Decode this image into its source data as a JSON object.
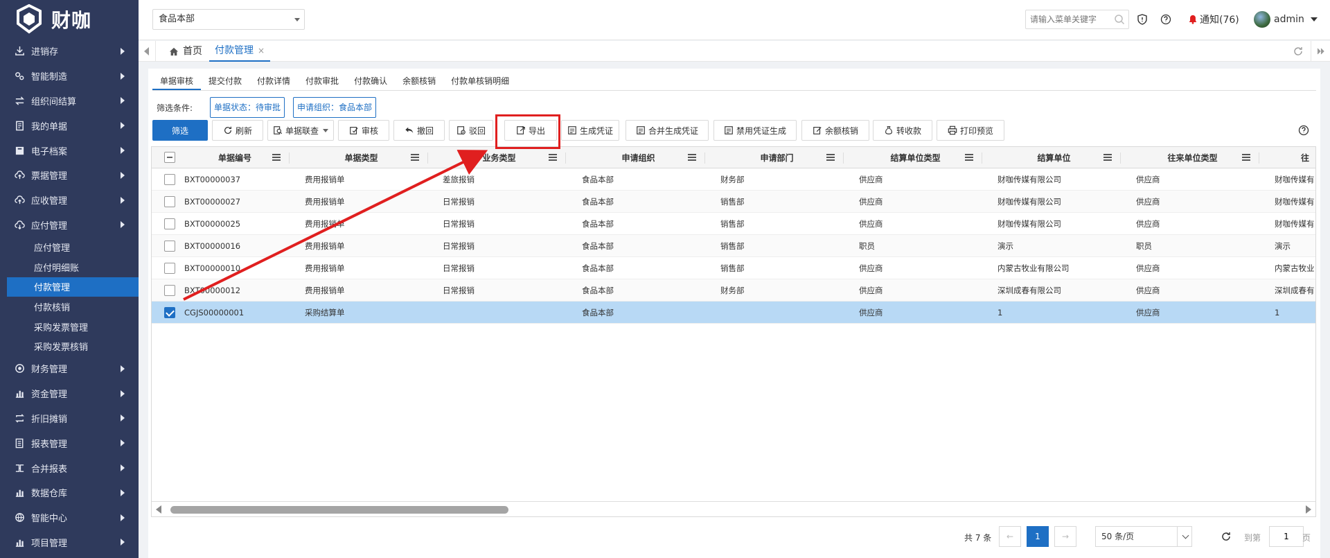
{
  "app": {
    "logo_text": "财咖"
  },
  "sidebar": {
    "items": [
      {
        "label": "进销存",
        "icon": "download-icon"
      },
      {
        "label": "智能制造",
        "icon": "gears-icon"
      },
      {
        "label": "组织间结算",
        "icon": "exchange-icon"
      },
      {
        "label": "我的单据",
        "icon": "document-icon"
      },
      {
        "label": "电子档案",
        "icon": "archive-icon"
      },
      {
        "label": "票据管理",
        "icon": "cloud-upload-icon"
      },
      {
        "label": "应收管理",
        "icon": "cloud-upload-icon"
      },
      {
        "label": "应付管理",
        "icon": "cloud-download-icon"
      }
    ],
    "submenu": [
      {
        "label": "应付管理"
      },
      {
        "label": "应付明细账"
      },
      {
        "label": "付款管理",
        "active": true
      },
      {
        "label": "付款核销"
      },
      {
        "label": "采购发票管理"
      },
      {
        "label": "采购发票核销"
      }
    ],
    "items_after": [
      {
        "label": "财务管理",
        "icon": "circle-dot-icon"
      },
      {
        "label": "资金管理",
        "icon": "bar-chart-icon"
      },
      {
        "label": "折旧摊销",
        "icon": "repeat-icon"
      },
      {
        "label": "报表管理",
        "icon": "report-icon"
      },
      {
        "label": "合并报表",
        "icon": "merge-icon"
      },
      {
        "label": "数据仓库",
        "icon": "bar-chart-icon"
      },
      {
        "label": "智能中心",
        "icon": "globe-icon"
      },
      {
        "label": "项目管理",
        "icon": "bar-chart-icon"
      }
    ]
  },
  "header": {
    "org_select": "食品本部",
    "search_placeholder": "请输入菜单关键字",
    "notification": "通知(76)",
    "username": "admin"
  },
  "tabs": {
    "home": "首页",
    "active": "付款管理",
    "close": "×"
  },
  "subtabs": [
    "单据审核",
    "提交付款",
    "付款详情",
    "付款审批",
    "付款确认",
    "余额核销",
    "付款单核销明细"
  ],
  "filter": {
    "label": "筛选条件:",
    "tags": [
      "单据状态：待审批",
      "申请组织：食品本部"
    ]
  },
  "toolbar": {
    "filter": "筛选",
    "refresh": "刷新",
    "linked": "单据联查",
    "audit": "审核",
    "withdraw": "撤回",
    "reject": "驳回",
    "export": "导出",
    "gen_voucher": "生成凭证",
    "merge_voucher": "合并生成凭证",
    "disable_voucher": "禁用凭证生成",
    "balance_writeoff": "余额核销",
    "transfer_receipt": "转收款",
    "print_preview": "打印预览"
  },
  "table": {
    "columns": [
      "单据编号",
      "单据类型",
      "业务类型",
      "申请组织",
      "申请部门",
      "结算单位类型",
      "结算单位",
      "往来单位类型",
      "往"
    ],
    "rows": [
      {
        "id": "BXT00000037",
        "type": "费用报销单",
        "biz": "差旅报销",
        "org": "食品本部",
        "dept": "财务部",
        "settle_type": "供应商",
        "settle_unit": "财咖传媒有限公司",
        "partner_type": "供应商",
        "partner": "财咖传媒有",
        "checked": false
      },
      {
        "id": "BXT00000027",
        "type": "费用报销单",
        "biz": "日常报销",
        "org": "食品本部",
        "dept": "销售部",
        "settle_type": "供应商",
        "settle_unit": "财咖传媒有限公司",
        "partner_type": "供应商",
        "partner": "财咖传媒有",
        "checked": false
      },
      {
        "id": "BXT00000025",
        "type": "费用报销单",
        "biz": "日常报销",
        "org": "食品本部",
        "dept": "销售部",
        "settle_type": "供应商",
        "settle_unit": "财咖传媒有限公司",
        "partner_type": "供应商",
        "partner": "财咖传媒有",
        "checked": false
      },
      {
        "id": "BXT00000016",
        "type": "费用报销单",
        "biz": "日常报销",
        "org": "食品本部",
        "dept": "销售部",
        "settle_type": "职员",
        "settle_unit": "演示",
        "partner_type": "职员",
        "partner": "演示",
        "checked": false
      },
      {
        "id": "BXT00000010",
        "type": "费用报销单",
        "biz": "日常报销",
        "org": "食品本部",
        "dept": "销售部",
        "settle_type": "供应商",
        "settle_unit": "内蒙古牧业有限公司",
        "partner_type": "供应商",
        "partner": "内蒙古牧业",
        "checked": false
      },
      {
        "id": "BXT00000012",
        "type": "费用报销单",
        "biz": "日常报销",
        "org": "食品本部",
        "dept": "财务部",
        "settle_type": "供应商",
        "settle_unit": "深圳成春有限公司",
        "partner_type": "供应商",
        "partner": "深圳成春有",
        "checked": false
      },
      {
        "id": "CGJS00000001",
        "type": "采购结算单",
        "biz": "",
        "org": "食品本部",
        "dept": "",
        "settle_type": "供应商",
        "settle_unit": "1",
        "partner_type": "供应商",
        "partner": "1",
        "checked": true
      }
    ]
  },
  "pager": {
    "total": "共 7 条",
    "current": "1",
    "prev": "←",
    "next": "→",
    "page_size": "50 条/页",
    "goto": "到第",
    "goto_value": "1",
    "unit": "页"
  },
  "colors": {
    "sidebar_bg": "#2f3a5c",
    "accent": "#1e6fc4",
    "selected_row": "#b8d9f5",
    "annotation": "#e01f1f"
  }
}
